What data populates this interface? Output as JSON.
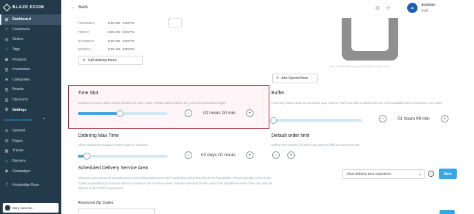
{
  "sidebar": {
    "brand": "BLAZE ECOM",
    "items": [
      {
        "label": "Dashboard",
        "icon": "dashboard-icon",
        "glyph": "▦",
        "active": true
      },
      {
        "label": "Customers",
        "icon": "customers-icon",
        "glyph": "☺"
      },
      {
        "label": "Orders",
        "icon": "orders-icon",
        "glyph": "▤"
      },
      {
        "label": "Tags",
        "icon": "tag-icon",
        "glyph": "⌂"
      },
      {
        "label": "Products",
        "icon": "products-icon",
        "glyph": "▣"
      },
      {
        "label": "Inventories",
        "icon": "inventory-icon",
        "glyph": "▥"
      },
      {
        "label": "Categories",
        "icon": "categories-icon",
        "glyph": "◈"
      },
      {
        "label": "Brands",
        "icon": "brands-icon",
        "glyph": "▧"
      },
      {
        "label": "Discounts",
        "icon": "discount-icon",
        "glyph": "▨"
      },
      {
        "label": "Settings",
        "icon": "gear-icon",
        "glyph": "⚙",
        "bold": true
      }
    ],
    "section": "SALES CHANNELS",
    "channel_items": [
      {
        "label": "General",
        "icon": "general-icon",
        "glyph": "⚙"
      },
      {
        "label": "Pages",
        "icon": "pages-icon",
        "glyph": "▤"
      },
      {
        "label": "Theme",
        "icon": "theme-icon",
        "glyph": "▦"
      },
      {
        "label": "Banners",
        "icon": "banner-icon",
        "glyph": "▭"
      },
      {
        "label": "Campaigns",
        "icon": "campaign-icon",
        "glyph": "◉"
      }
    ],
    "knowledge_base": "Knowledge Base",
    "user_card": "Mary Jane Ma..."
  },
  "topbar": {
    "back_label": "Back",
    "user_initials": "JN",
    "user_name": "Jochen",
    "user_role": "Staff"
  },
  "hours": [
    {
      "day": "THURSDAY",
      "time": "8:00 AM - 8:00 PM"
    },
    {
      "day": "FRIDAY",
      "time": "8:00 AM - 8:00 PM"
    },
    {
      "day": "SATURDAY",
      "time": "8:00 AM - 8:00 PM"
    },
    {
      "day": "SUNDAY",
      "time": "8:00 AM - 8:00 PM"
    }
  ],
  "edit_delivery_hours": "Edit delivery hours",
  "no_store_text": "NO STORE/SPECIAL HOURS/DELIVERY YET.",
  "add_special_hour": "Add Special Hour",
  "time_slot": {
    "title": "Time Slot",
    "desc": "Customers must select a time window for their order. Please define below the your time windows length.",
    "value": "02 hours 00 min",
    "slider_fraction": 0.47
  },
  "buffer": {
    "title": "Buffer",
    "desc": "How long does it take to complete your orders? We'll use this to determine the next available time a customer can order.",
    "value": "01 hours 00 min",
    "slider_fraction": 0.0
  },
  "ordering_max_time": {
    "title": "Ordering Max Time",
    "desc": "Allow customers to place orders days in advance.",
    "value": "02 days 00 hours",
    "slider_fraction": 0.1
  },
  "default_order_limit": {
    "title": "Default order limit",
    "desc": "Define the number of orders are able to fulfill in each time slot."
  },
  "scheduled_area": {
    "title": "Scheduled Delivery Service Area",
    "desc": "What are your areas of operations for Scheduled Deliveries? We'll read that value from the POS if available. Please provide a list of Zip Codes separated by commas where customers can receive orders. Please note that Zones cannot be (re)defined here; they can only be defined in the POS if supported.",
    "select_value": "Allow delivery area restrictions",
    "save_label": "Save"
  },
  "restricted_zip_label": "Restricted Zip Codes",
  "colors": {
    "sidebar_bg": "#233a4a",
    "accent": "#35a7e8",
    "highlight_border": "#9b2131"
  }
}
